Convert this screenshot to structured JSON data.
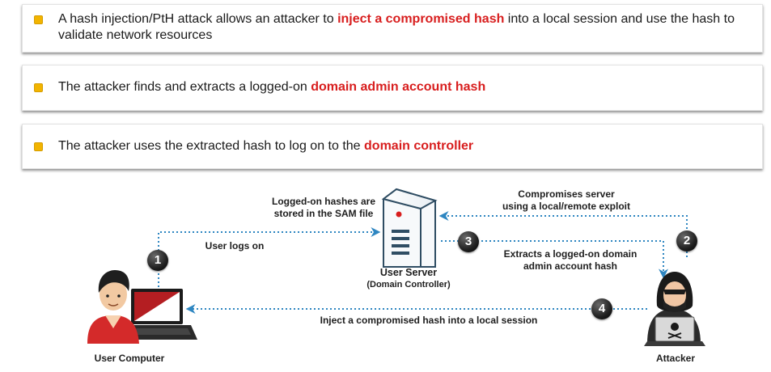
{
  "bullets": [
    {
      "pre": "A hash injection/PtH attack allows an attacker to ",
      "highlight": "inject a compromised hash",
      "post": " into a local session and use the hash to validate network resources"
    },
    {
      "pre": "The attacker finds and extracts a logged-on ",
      "highlight": "domain admin account hash",
      "post": ""
    },
    {
      "pre": "The attacker uses the extracted hash to log on to the ",
      "highlight": "domain controller",
      "post": ""
    }
  ],
  "diagram": {
    "sam_note_line1": "Logged-on hashes are",
    "sam_note_line2": "stored in the SAM file",
    "compromise_line1": "Compromises server",
    "compromise_line2": "using a local/remote exploit",
    "user_logs_on": "User logs on",
    "extract_line1": "Extracts a logged-on domain",
    "extract_line2": "admin account hash",
    "server_name": "User Server",
    "server_role": "(Domain Controller)",
    "inject_label": "Inject a compromised hash into a local session",
    "user_computer": "User Computer",
    "attacker": "Attacker",
    "steps": [
      "1",
      "2",
      "3",
      "4"
    ]
  },
  "colors": {
    "accent_red": "#d81e1e",
    "bullet_yellow": "#f2b400",
    "arrow_blue": "#2e86c1"
  }
}
